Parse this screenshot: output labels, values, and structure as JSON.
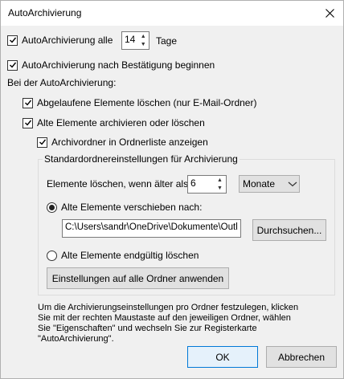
{
  "window": {
    "title": "AutoArchivierung",
    "close_icon": "close-icon"
  },
  "auto_archive_every": {
    "label": "AutoArchivierung alle",
    "checked": true,
    "value": "14",
    "unit": "Tage"
  },
  "confirm_before": {
    "label": "AutoArchivierung nach Bestätigung beginnen",
    "checked": true
  },
  "during_label": "Bei der AutoArchivierung:",
  "options": {
    "delete_expired": {
      "label": "Abgelaufene Elemente löschen (nur E-Mail-Ordner)",
      "checked": true
    },
    "archive_old": {
      "label": "Alte Elemente archivieren oder löschen",
      "checked": true
    },
    "show_archive_folder": {
      "label": "Archivordner in Ordnerliste anzeigen",
      "checked": true
    }
  },
  "defaults_group": {
    "title": "Standardordnereinstellungen für Archivierung",
    "older_than_label": "Elemente löschen, wenn älter als",
    "older_than_value": "6",
    "unit_selected": "Monate",
    "move_to_label": "Alte Elemente verschieben nach:",
    "move_to_selected": true,
    "path_value": "C:\\Users\\sandr\\OneDrive\\Dokumente\\Outl",
    "browse_button": "Durchsuchen...",
    "delete_permanently_label": "Alte Elemente endgültig löschen",
    "delete_permanently_selected": false,
    "apply_all_button": "Einstellungen auf alle Ordner anwenden"
  },
  "info_text": [
    "Um die Archivierungseinstellungen pro Ordner festzulegen, klicken",
    "Sie mit der rechten Maustaste auf den jeweiligen Ordner, wählen",
    "Sie \"Eigenschaften\" und wechseln Sie zur Registerkarte",
    "\"AutoArchivierung\"."
  ],
  "buttons": {
    "ok": "OK",
    "cancel": "Abbrechen"
  }
}
